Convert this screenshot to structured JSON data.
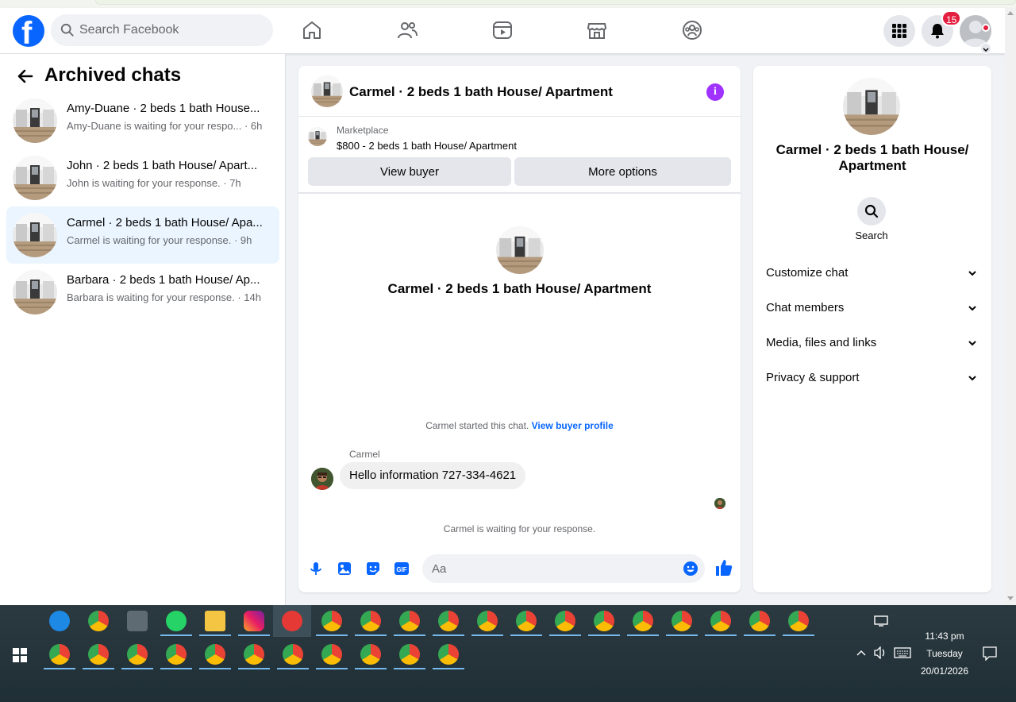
{
  "header": {
    "search_placeholder": "Search Facebook",
    "notification_count": "15"
  },
  "sidebar": {
    "title": "Archived chats",
    "chats": [
      {
        "name": "Amy-Duane · 2 beds 1 bath House...",
        "preview": "Amy-Duane is waiting for your respo... · 6h"
      },
      {
        "name": "John · 2 beds 1 bath House/ Apart...",
        "preview": "John is waiting for your response. · 7h"
      },
      {
        "name": "Carmel · 2 beds 1 bath House/ Apa...",
        "preview": "Carmel is waiting for your response. · 9h"
      },
      {
        "name": "Barbara · 2 beds 1 bath House/ Ap...",
        "preview": "Barbara is waiting for your response. · 14h"
      }
    ]
  },
  "conversation": {
    "title": "Carmel · 2 beds 1 bath House/ Apartment",
    "marketplace_label": "Marketplace",
    "listing": "$800 - 2 beds 1 bath House/ Apartment",
    "view_buyer": "View buyer",
    "more_options": "More options",
    "center_name": "Carmel · 2 beds 1 bath House/ Apartment",
    "started_text": "Carmel started this chat.",
    "started_link": "View buyer profile",
    "sender": "Carmel",
    "message": "Hello information 727-334-4621",
    "waiting": "Carmel is waiting for your response.",
    "composer_placeholder": "Aa"
  },
  "details": {
    "name": "Carmel · 2 beds 1 bath House/ Apartment",
    "search_label": "Search",
    "sections": [
      "Customize chat",
      "Chat members",
      "Media, files and links",
      "Privacy & support"
    ]
  },
  "taskbar": {
    "time": "11:43 pm",
    "day": "Tuesday",
    "date": "20/01/2026"
  },
  "colors": {
    "brand": "#0866ff",
    "active_chat_bg": "#ebf5ff",
    "info_purple": "#a033ff",
    "badge_red": "#e41e3f"
  }
}
